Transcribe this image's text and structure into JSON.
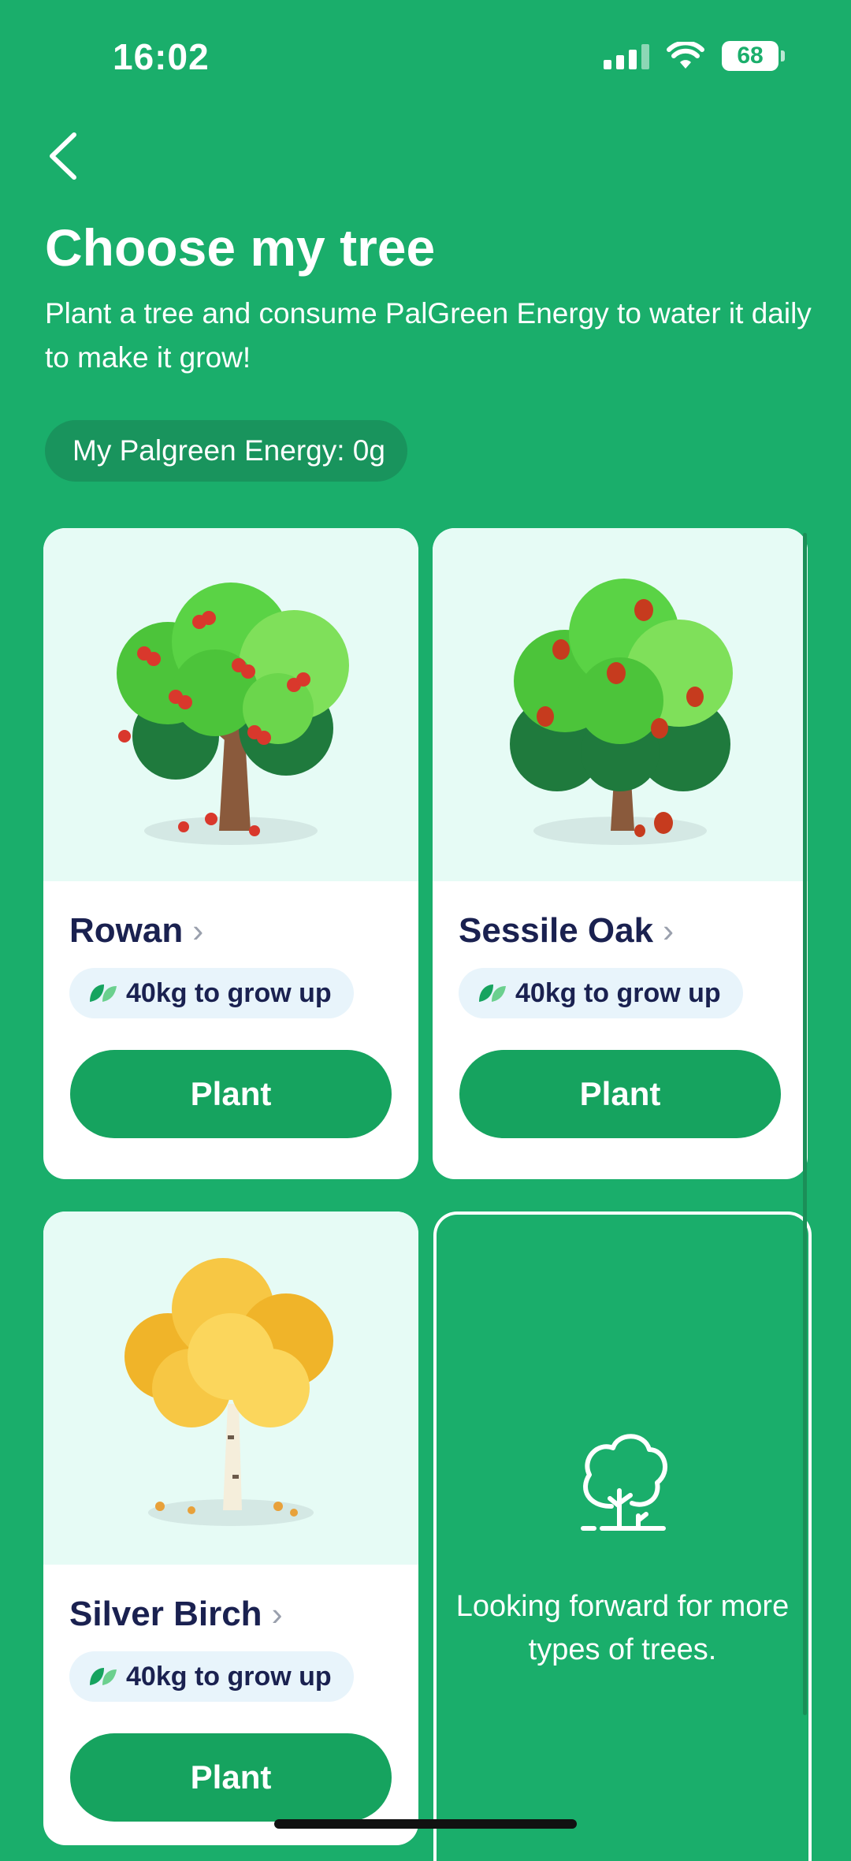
{
  "status_bar": {
    "time": "16:02",
    "battery": "68"
  },
  "header": {
    "title": "Choose my tree",
    "subtitle": "Plant a tree and consume PalGreen Energy to water it daily to make it grow!",
    "energy": "My Palgreen Energy: 0g"
  },
  "trees": [
    {
      "name": "Rowan",
      "grow": "40kg to grow up",
      "button": "Plant"
    },
    {
      "name": "Sessile Oak",
      "grow": "40kg to grow up",
      "button": "Plant"
    },
    {
      "name": "Silver Birch",
      "grow": "40kg to grow up",
      "button": "Plant"
    }
  ],
  "coming_soon": {
    "message": "Looking forward for more types of trees."
  },
  "colors": {
    "background": "#1aae6b",
    "button": "#16a35f",
    "card_art_bg": "#e6fbf5",
    "text_dark": "#1a2150"
  }
}
